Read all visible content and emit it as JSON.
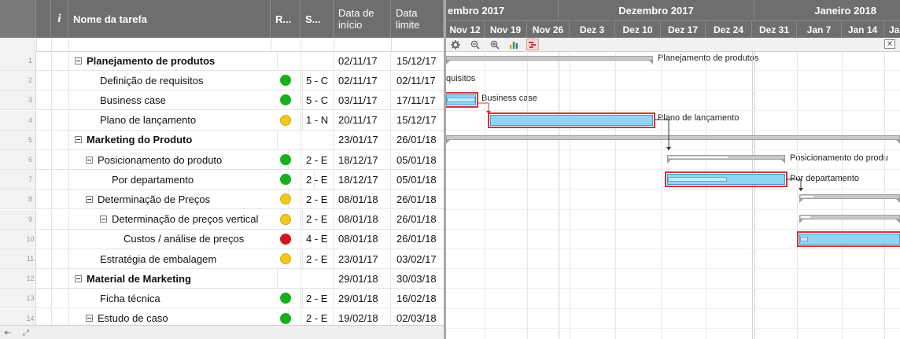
{
  "grid": {
    "columns": {
      "info": "i",
      "name": "Nome da tarefa",
      "resource": "R...",
      "status": "S...",
      "start": "Data de início",
      "end": "Data limite"
    },
    "rows": [
      {
        "num": "1",
        "name": "Planejamento de produtos",
        "level": 0,
        "parent": true,
        "dot": "",
        "status": "",
        "start": "02/11/17",
        "end": "15/12/17"
      },
      {
        "num": "2",
        "name": "Definição de requisitos",
        "level": 2,
        "parent": false,
        "dot": "green",
        "status": "5 - C",
        "start": "02/11/17",
        "end": "02/11/17"
      },
      {
        "num": "3",
        "name": "Business case",
        "level": 2,
        "parent": false,
        "dot": "green",
        "status": "5 - C",
        "start": "03/11/17",
        "end": "17/11/17"
      },
      {
        "num": "4",
        "name": "Plano de lançamento",
        "level": 2,
        "parent": false,
        "dot": "yellow",
        "status": "1 - N",
        "start": "20/11/17",
        "end": "15/12/17"
      },
      {
        "num": "5",
        "name": "Marketing do Produto",
        "level": 0,
        "parent": true,
        "dot": "",
        "status": "",
        "start": "23/01/17",
        "end": "26/01/18"
      },
      {
        "num": "6",
        "name": "Posicionamento do produto",
        "level": 1,
        "parent": true,
        "bold": false,
        "dot": "green",
        "status": "2 - E",
        "start": "18/12/17",
        "end": "05/01/18"
      },
      {
        "num": "7",
        "name": "Por departamento",
        "level": 3,
        "parent": false,
        "dot": "green",
        "status": "2 - E",
        "start": "18/12/17",
        "end": "05/01/18"
      },
      {
        "num": "8",
        "name": "Determinação de Preços",
        "level": 1,
        "parent": true,
        "bold": false,
        "dot": "yellow",
        "status": "2 - E",
        "start": "08/01/18",
        "end": "26/01/18"
      },
      {
        "num": "9",
        "name": "Determinação de preços vertical",
        "level": 2,
        "parent": true,
        "bold": false,
        "dot": "yellow",
        "status": "2 - E",
        "start": "08/01/18",
        "end": "26/01/18"
      },
      {
        "num": "10",
        "name": "Custos / análise de preços",
        "level": 4,
        "parent": false,
        "dot": "red",
        "status": "4 - E",
        "start": "08/01/18",
        "end": "26/01/18"
      },
      {
        "num": "11",
        "name": "Estratégia de embalagem",
        "level": 2,
        "parent": false,
        "dot": "yellow",
        "status": "2 - E",
        "start": "23/01/17",
        "end": "03/02/17"
      },
      {
        "num": "12",
        "name": "Material de Marketing",
        "level": 0,
        "parent": true,
        "dot": "",
        "status": "",
        "start": "29/01/18",
        "end": "30/03/18"
      },
      {
        "num": "13",
        "name": "Ficha técnica",
        "level": 2,
        "parent": false,
        "dot": "green",
        "status": "2 - E",
        "start": "29/01/18",
        "end": "16/02/18"
      },
      {
        "num": "14",
        "name": "Estudo de caso",
        "level": 1,
        "parent": true,
        "bold": false,
        "dot": "green",
        "status": "2 - E",
        "start": "19/02/18",
        "end": "02/03/18"
      }
    ]
  },
  "gantt": {
    "months": [
      "embro 2017",
      "Dezembro 2017",
      "Janeiro 2018"
    ],
    "weeks": [
      "Nov 12",
      "Nov 19",
      "Nov 26",
      "Dez 3",
      "Dez 10",
      "Dez 17",
      "Dez 24",
      "Dez 31",
      "Jan 7",
      "Jan 14",
      "Jan"
    ],
    "labels": {
      "r1": "Planejamento de produtos",
      "r2": "quisitos",
      "r3": "Business case",
      "r4": "Plano de lançamento",
      "r6": "Posicionamento do produ",
      "r7": "Por departamento"
    }
  },
  "colors": {
    "header": "#6e6e6e",
    "task_bar": "#8fd6f5",
    "critical_outline": "#d0343a",
    "summary_bar": "#c8c8c8",
    "green": "#17b01b",
    "yellow": "#f1c91d",
    "red": "#d0181e"
  }
}
